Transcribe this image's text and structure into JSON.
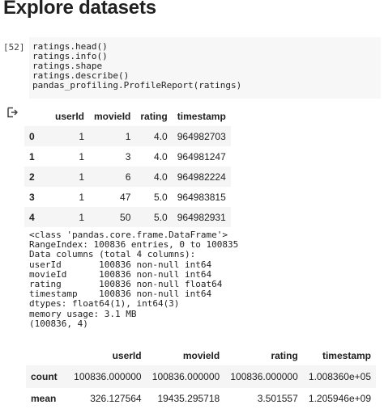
{
  "heading": "Explore datasets",
  "cell": {
    "execution_count": "[52]",
    "code_lines": [
      "ratings.head()",
      "ratings.info()",
      "ratings.shape",
      "ratings.describe()",
      "pandas_profiling.ProfileReport(ratings)"
    ]
  },
  "output_icon": "output-arrow-icon",
  "head_table": {
    "columns": [
      "",
      "userId",
      "movieId",
      "rating",
      "timestamp"
    ],
    "rows": [
      [
        "0",
        "1",
        "1",
        "4.0",
        "964982703"
      ],
      [
        "1",
        "1",
        "3",
        "4.0",
        "964981247"
      ],
      [
        "2",
        "1",
        "6",
        "4.0",
        "964982224"
      ],
      [
        "3",
        "1",
        "47",
        "5.0",
        "964983815"
      ],
      [
        "4",
        "1",
        "50",
        "5.0",
        "964982931"
      ]
    ]
  },
  "info_output": [
    "<class 'pandas.core.frame.DataFrame'>",
    "RangeIndex: 100836 entries, 0 to 100835",
    "Data columns (total 4 columns):",
    "userId       100836 non-null int64",
    "movieId      100836 non-null int64",
    "rating       100836 non-null float64",
    "timestamp    100836 non-null int64",
    "dtypes: float64(1), int64(3)",
    "memory usage: 3.1 MB",
    "(100836, 4)"
  ],
  "describe_table": {
    "columns": [
      "",
      "userId",
      "movieId",
      "rating",
      "timestamp"
    ],
    "rows": [
      [
        "count",
        "100836.000000",
        "100836.000000",
        "100836.000000",
        "1.008360e+05"
      ],
      [
        "mean",
        "326.127564",
        "19435.295718",
        "3.501557",
        "1.205946e+09"
      ]
    ]
  },
  "colors": {
    "code_background": "#f7f7f7",
    "stripe": "#f5f5f5",
    "text": "#212121"
  }
}
